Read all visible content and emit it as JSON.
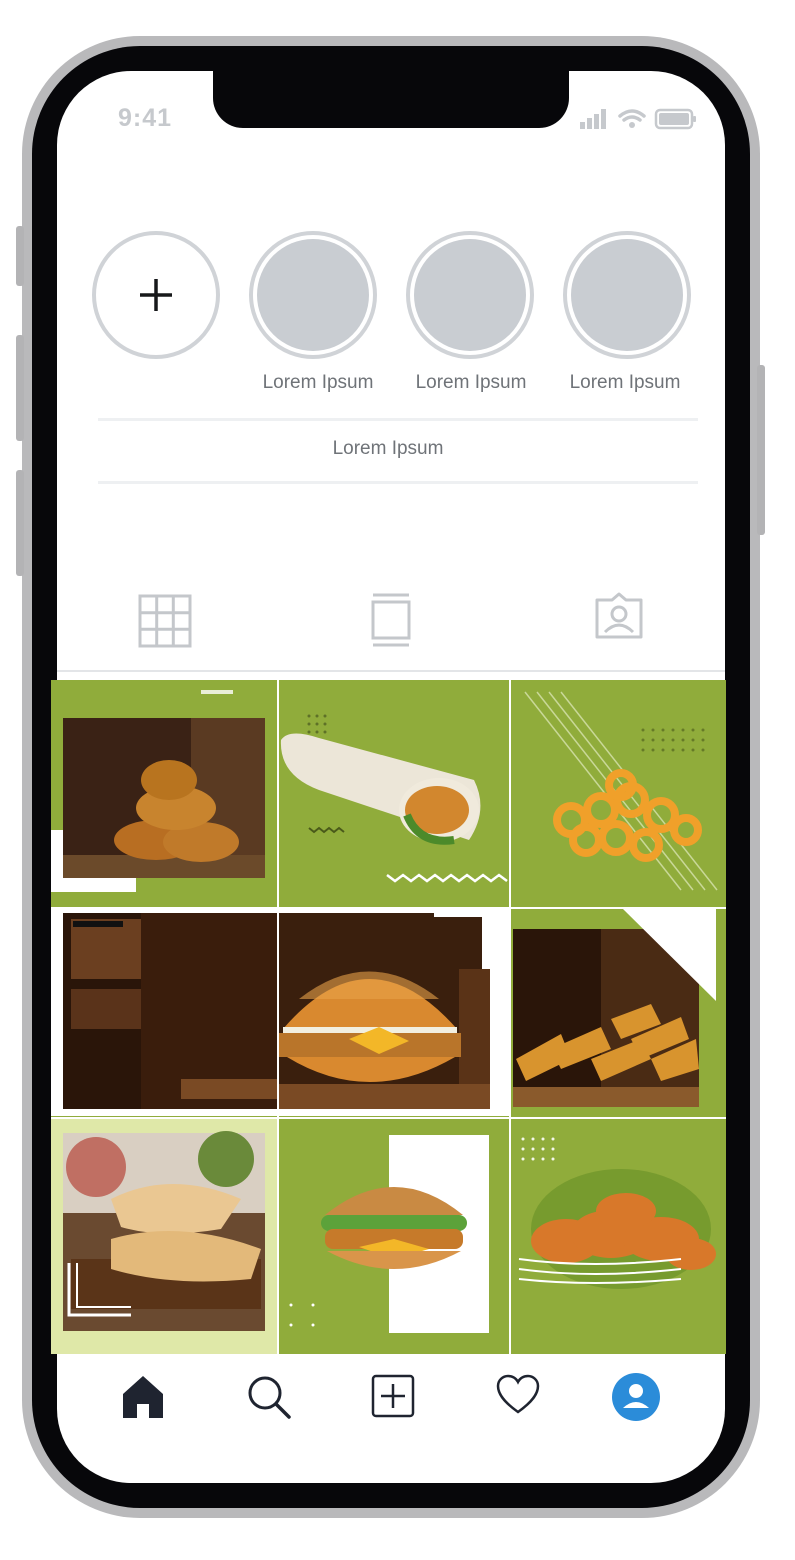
{
  "status_bar": {
    "time": "9:41"
  },
  "stories": [
    {
      "label": ""
    },
    {
      "label": "Lorem Ipsum"
    },
    {
      "label": "Lorem Ipsum"
    },
    {
      "label": "Lorem Ipsum"
    }
  ],
  "highlight": {
    "label": "Lorem Ipsum"
  },
  "tabs": [
    {
      "icon": "grid-icon"
    },
    {
      "icon": "reels-icon"
    },
    {
      "icon": "tagged-icon"
    }
  ],
  "posts": [
    {
      "icon": "chicken-nuggets-image"
    },
    {
      "icon": "chicken-wrap-image"
    },
    {
      "icon": "curly-fries-image"
    },
    {
      "icon": "wooden-table-image"
    },
    {
      "icon": "chicken-burger-image"
    },
    {
      "icon": "potato-wedges-image"
    },
    {
      "icon": "stuffed-pastry-image"
    },
    {
      "icon": "cheeseburger-image"
    },
    {
      "icon": "fried-chicken-image"
    }
  ],
  "bottom_nav": [
    {
      "icon": "home-icon"
    },
    {
      "icon": "search-icon"
    },
    {
      "icon": "add-post-icon"
    },
    {
      "icon": "heart-icon"
    },
    {
      "icon": "profile-icon"
    }
  ],
  "colors": {
    "accent_green": "#90ac3b",
    "profile_blue": "#2b8cd9",
    "frame": "#b9b9bb"
  }
}
